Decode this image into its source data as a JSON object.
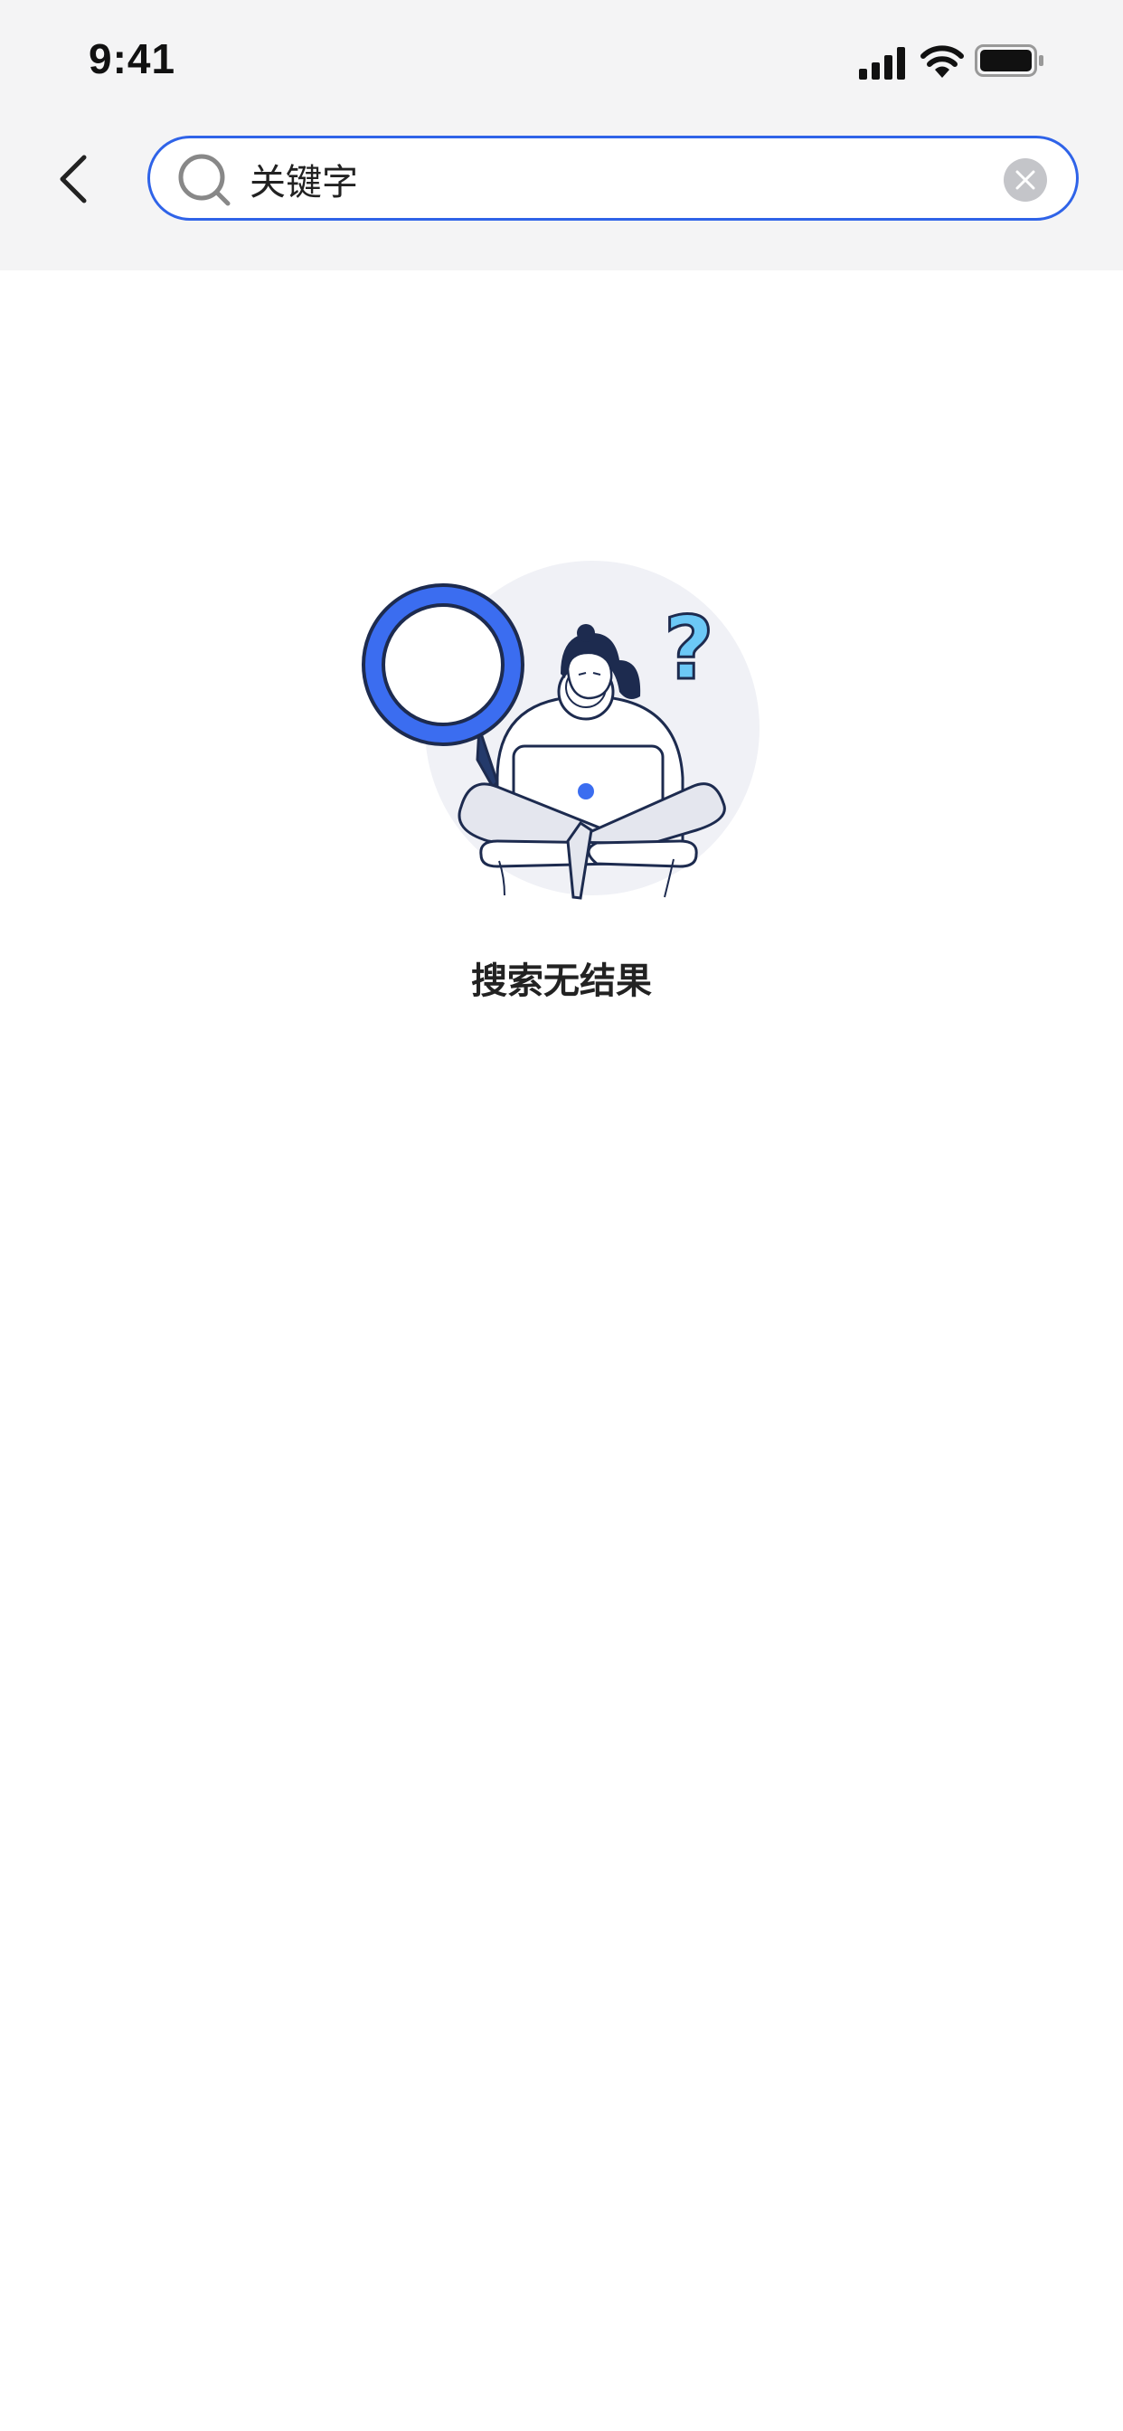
{
  "status_bar": {
    "time": "9:41",
    "icons": [
      "signal-icon",
      "wifi-icon",
      "battery-icon"
    ]
  },
  "search": {
    "value": "关键字",
    "accent_color": "#2f63e8"
  },
  "icons": {
    "back": "back-icon",
    "search": "search-icon",
    "clear": "close-icon"
  },
  "empty_state": {
    "illustration": "person-with-laptop-and-magnifier",
    "message": "搜索无结果"
  }
}
